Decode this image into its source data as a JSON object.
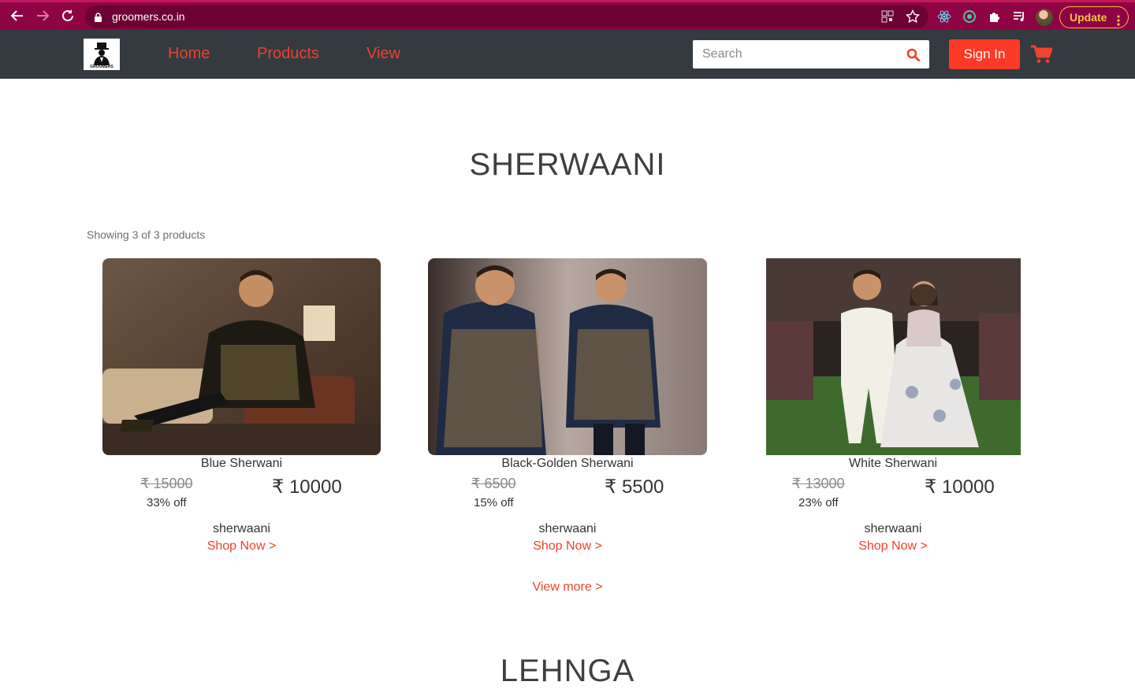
{
  "browser": {
    "url": "groomers.co.in",
    "update_label": "Update"
  },
  "navbar": {
    "logo_text": "GROOMERS",
    "links": [
      "Home",
      "Products",
      "View"
    ],
    "search_placeholder": "Search",
    "signin_label": "Sign In"
  },
  "section": {
    "title": "SHERWAANI",
    "showing": "Showing 3 of 3 products",
    "view_more": "View more >",
    "next_title": "LEHNGA"
  },
  "products": [
    {
      "name": "Blue Sherwani",
      "old_price": "₹ 15000",
      "discount": "33% off",
      "price": "₹ 10000",
      "category": "sherwaani",
      "cta": "Shop Now >"
    },
    {
      "name": "Black-Golden Sherwani",
      "old_price": "₹ 6500",
      "discount": "15% off",
      "price": "₹ 5500",
      "category": "sherwaani",
      "cta": "Shop Now >"
    },
    {
      "name": "White Sherwani",
      "old_price": "₹ 13000",
      "discount": "23% off",
      "price": "₹ 10000",
      "category": "sherwaani",
      "cta": "Shop Now >"
    }
  ],
  "colors": {
    "chrome": "#8e0343",
    "navbar": "#343a40",
    "accent": "#f0422c",
    "signin": "#fd3a25"
  }
}
